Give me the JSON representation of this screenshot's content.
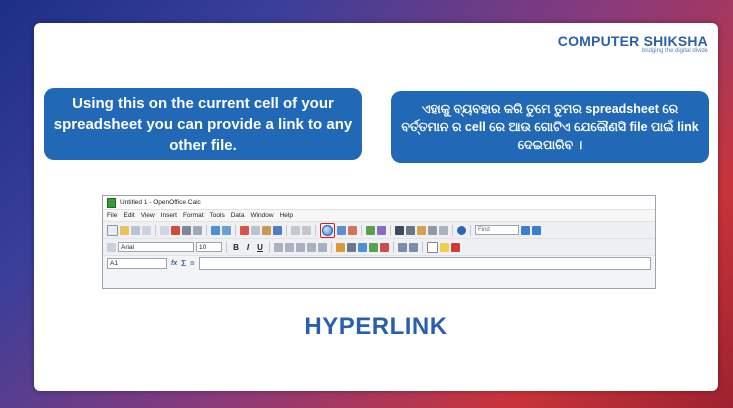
{
  "logo": {
    "title": "COMPUTER SHIKSHA",
    "tagline": "bridging the digital divide"
  },
  "bubble_left": {
    "text": "Using this on the current cell of your spreadsheet you can provide a link to any other file."
  },
  "bubble_right": {
    "text": "ଏହାକୁ ବ୍ୟବହାର କରି ତୁମେ ତୁମର spreadsheet ରେ ବର୍ତ୍ତମାନ ର cell ରେ ଆଉ ଗୋଟିଏ ଯେକୌଣସି file ପାଇଁ link ଦେଇପାରିବ ।"
  },
  "app": {
    "window_title": "Untitled 1 - OpenOffice Calc",
    "menu": [
      "File",
      "Edit",
      "View",
      "Insert",
      "Format",
      "Tools",
      "Data",
      "Window",
      "Help"
    ],
    "find_placeholder": "Find",
    "font_name": "Arial",
    "font_size": "10",
    "bold": "B",
    "italic": "I",
    "underline": "U",
    "cell_ref": "A1",
    "fx_symbol": "fx",
    "sum_symbol": "Σ",
    "equals_symbol": "="
  },
  "headline": "HYPERLINK",
  "colors": {
    "bubble": "#2168b6",
    "headline": "#2a5fb0",
    "highlight": "#cc1f1f"
  }
}
